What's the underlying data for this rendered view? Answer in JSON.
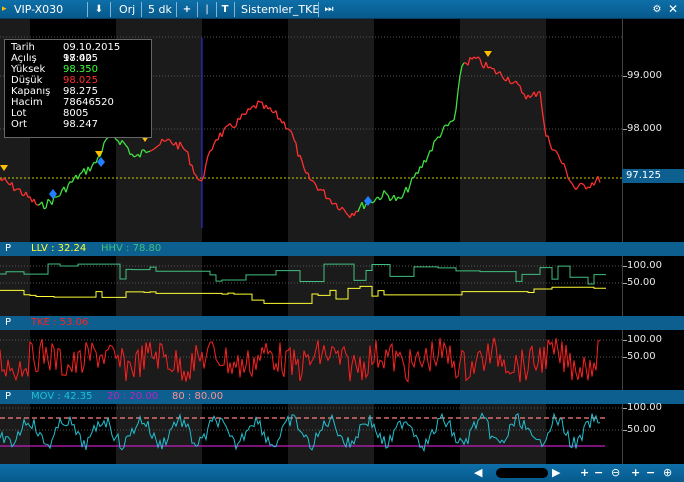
{
  "toolbar": {
    "symbol": "VIP-X030",
    "download_icon": "arrow-down-icon",
    "price_type": "Orj",
    "period": "5 dk",
    "add_icon": "plus-icon",
    "indicator": "Sistemler_TKE"
  },
  "info_box": {
    "rows": [
      {
        "key": "Tarih",
        "value": "09.10.2015 17:40",
        "color": "#ffffff"
      },
      {
        "key": "Açılış",
        "value": "98.025",
        "color": "#ffffff"
      },
      {
        "key": "Yüksek",
        "value": "98.350",
        "color": "#3cff3c"
      },
      {
        "key": "Düşük",
        "value": "98.025",
        "color": "#ff3030"
      },
      {
        "key": "Kapanış",
        "value": "98.275",
        "color": "#ffffff"
      },
      {
        "key": "Hacim",
        "value": "78646520",
        "color": "#ffffff"
      },
      {
        "key": "Lot",
        "value": "8005",
        "color": "#ffffff"
      },
      {
        "key": "Ort",
        "value": "98.247",
        "color": "#ffffff"
      }
    ]
  },
  "price_axis": {
    "labels": [
      "99.000",
      "98.000"
    ],
    "last_price": "97.125"
  },
  "panel_llv": {
    "p": "P",
    "llv_label": "LLV : 32.24",
    "hhv_label": "HHV : 78.80",
    "axis": [
      "100.00",
      "50.00"
    ],
    "colors": {
      "llv": "#ffff33",
      "hhv": "#40c080"
    }
  },
  "panel_tke": {
    "p": "P",
    "tke_label": "TKE : 53.06",
    "axis": [
      "100.00",
      "50.00"
    ],
    "colors": {
      "tke": "#ff2020"
    }
  },
  "panel_mov": {
    "p": "P",
    "mov_label": "MOV : 42.35",
    "lower_label": "20 : 20.00",
    "upper_label": "80 : 80.00",
    "axis": [
      "100.00",
      "50.00"
    ],
    "colors": {
      "mov": "#20c0d0",
      "lower": "#c020c0",
      "upper": "#ff8080"
    }
  },
  "colors": {
    "accent": "#0c5f8f",
    "up": "#40e040",
    "down": "#ff3030",
    "marker_buy": "#2080ff",
    "marker_sell": "#ffc000",
    "last_price_line": "#c8c800"
  }
}
